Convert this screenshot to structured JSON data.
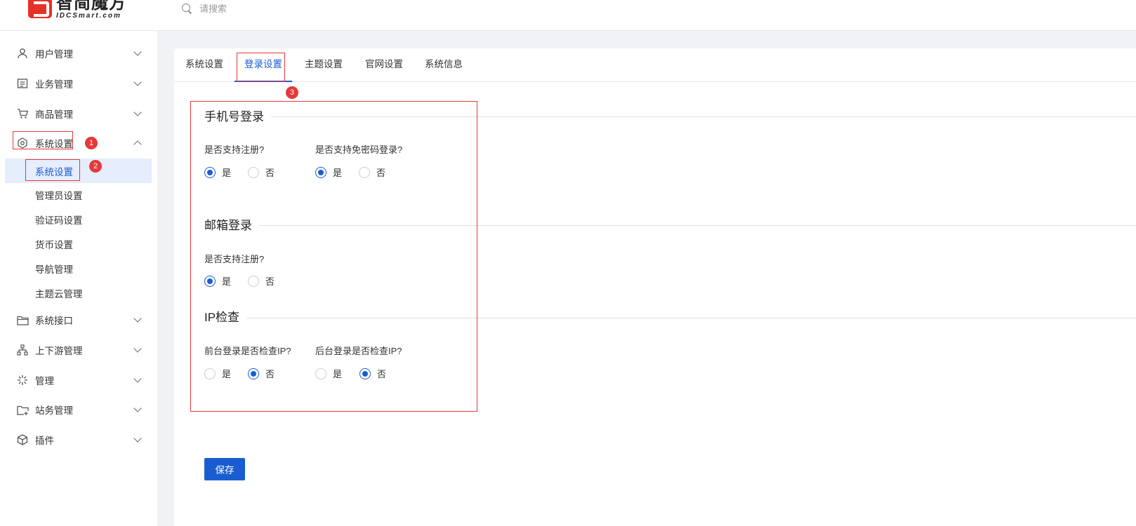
{
  "header": {
    "logo_cn": "智简魔方",
    "logo_en": "IDCSmart.com",
    "search_placeholder": "请搜索"
  },
  "sidebar": {
    "items": [
      {
        "label": "用户管理",
        "icon": "user-icon",
        "expanded": false
      },
      {
        "label": "业务管理",
        "icon": "document-icon",
        "expanded": false
      },
      {
        "label": "商品管理",
        "icon": "cart-icon",
        "expanded": false
      },
      {
        "label": "系统设置",
        "icon": "hexagon-gear-icon",
        "expanded": true
      },
      {
        "label": "系统接口",
        "icon": "folder-icon",
        "expanded": false
      },
      {
        "label": "上下游管理",
        "icon": "hierarchy-icon",
        "expanded": false
      },
      {
        "label": "管理",
        "icon": "burst-icon",
        "expanded": false
      },
      {
        "label": "站务管理",
        "icon": "folder-plus-icon",
        "expanded": false
      },
      {
        "label": "插件",
        "icon": "cube-icon",
        "expanded": false
      }
    ],
    "sub_items": [
      {
        "label": "系统设置",
        "active": true
      },
      {
        "label": "管理员设置",
        "active": false
      },
      {
        "label": "验证码设置",
        "active": false
      },
      {
        "label": "货币设置",
        "active": false
      },
      {
        "label": "导航管理",
        "active": false
      },
      {
        "label": "主题云管理",
        "active": false
      }
    ]
  },
  "tabs": [
    {
      "label": "系统设置",
      "active": false
    },
    {
      "label": "登录设置",
      "active": true
    },
    {
      "label": "主题设置",
      "active": false
    },
    {
      "label": "官网设置",
      "active": false
    },
    {
      "label": "系统信息",
      "active": false
    }
  ],
  "sections": {
    "phone": {
      "title": "手机号登录",
      "q1": {
        "label": "是否支持注册?",
        "value": "是"
      },
      "q2": {
        "label": "是否支持免密码登录?",
        "value": "是"
      }
    },
    "email": {
      "title": "邮箱登录",
      "q1": {
        "label": "是否支持注册?",
        "value": "是"
      }
    },
    "ip": {
      "title": "IP检查",
      "q1": {
        "label": "前台登录是否检查IP?",
        "value": "否"
      },
      "q2": {
        "label": "后台登录是否检查IP?",
        "value": "否"
      }
    }
  },
  "options": {
    "yes": "是",
    "no": "否"
  },
  "save_label": "保存",
  "annotations": {
    "badge1": "1",
    "badge2": "2",
    "badge3": "3"
  },
  "colors": {
    "primary": "#1a5dd1",
    "annotation": "#e5393a",
    "active_bg": "#e6edfd"
  }
}
